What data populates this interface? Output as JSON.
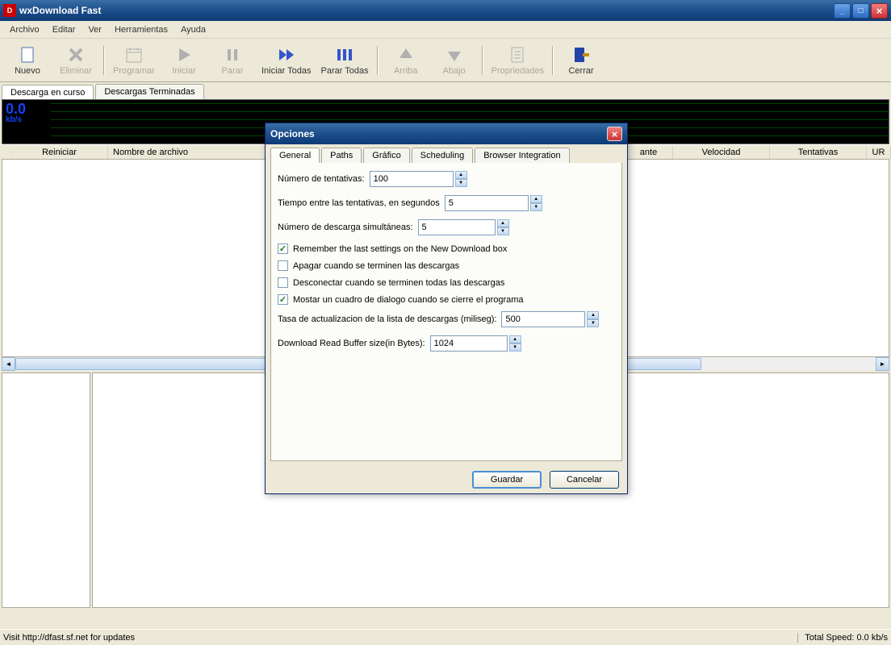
{
  "window": {
    "title": "wxDownload Fast"
  },
  "menu": [
    "Archivo",
    "Editar",
    "Ver",
    "Herramientas",
    "Ayuda"
  ],
  "toolbar": [
    {
      "label": "Nuevo",
      "icon": "file-new",
      "enabled": true
    },
    {
      "label": "Eliminar",
      "icon": "delete",
      "enabled": false
    },
    {
      "sep": true
    },
    {
      "label": "Programar",
      "icon": "schedule",
      "enabled": false
    },
    {
      "label": "Iniciar",
      "icon": "play",
      "enabled": false
    },
    {
      "label": "Parar",
      "icon": "pause",
      "enabled": false
    },
    {
      "label": "Iniciar Todas",
      "icon": "play-all",
      "enabled": true
    },
    {
      "label": "Parar Todas",
      "icon": "pause-all",
      "enabled": true
    },
    {
      "sep": true
    },
    {
      "label": "Arriba",
      "icon": "up",
      "enabled": false
    },
    {
      "label": "Abajo",
      "icon": "down",
      "enabled": false
    },
    {
      "sep": true
    },
    {
      "label": "Propriedades",
      "icon": "props",
      "enabled": false
    },
    {
      "sep": true
    },
    {
      "label": "Cerrar",
      "icon": "close",
      "enabled": true
    }
  ],
  "main_tabs": [
    {
      "label": "Descarga en curso",
      "active": true
    },
    {
      "label": "Descargas Terminadas",
      "active": false
    }
  ],
  "graph_speed": {
    "value": "0.0",
    "unit": "kb/s"
  },
  "columns": [
    "Reiniciar",
    "Nombre de archivo",
    "ante",
    "Velocidad",
    "Tentativas",
    "UR"
  ],
  "status": {
    "left": "Visit http://dfast.sf.net for updates",
    "right": "Total Speed: 0.0 kb/s"
  },
  "dialog": {
    "title": "Opciones",
    "tabs": [
      "General",
      "Paths",
      "Gráfico",
      "Scheduling",
      "Browser Integration"
    ],
    "active_tab": 0,
    "fields": {
      "tentativas_label": "Número de tentativas:",
      "tentativas_value": "100",
      "tiempo_label": "Tiempo entre las tentativas, en segundos",
      "tiempo_value": "5",
      "simultaneas_label": "Número de descarga simultáneas:",
      "simultaneas_value": "5",
      "remember_label": "Remember the last settings on the New Download box",
      "remember_checked": true,
      "apagar_label": "Apagar cuando se terminen las descargas",
      "apagar_checked": false,
      "desconectar_label": "Desconectar cuando se terminen todas las descargas",
      "desconectar_checked": false,
      "mostrar_label": "Mostar un cuadro de dialogo cuando se cierre el programa",
      "mostrar_checked": true,
      "tasa_label": "Tasa de actualizacion de la lista de descargas (miliseg):",
      "tasa_value": "500",
      "buffer_label": "Download Read Buffer size(in Bytes):",
      "buffer_value": "1024"
    },
    "buttons": {
      "save": "Guardar",
      "cancel": "Cancelar"
    }
  }
}
